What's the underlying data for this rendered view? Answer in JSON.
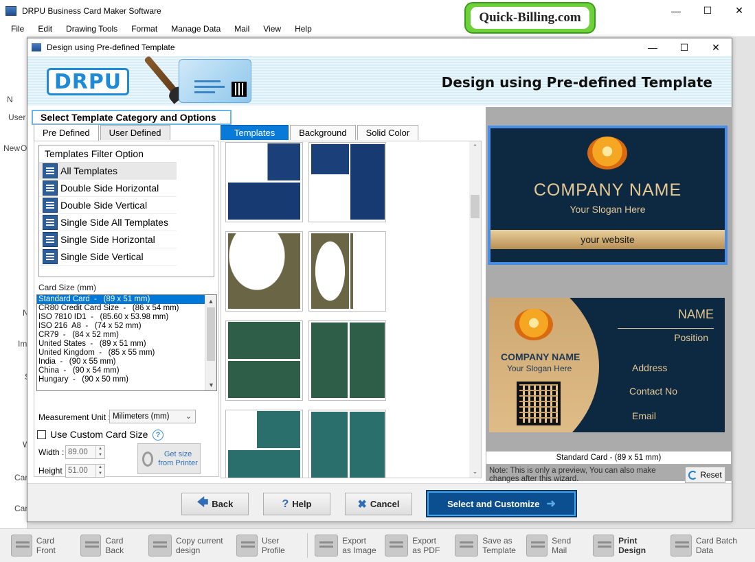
{
  "app": {
    "title": "DRPU Business Card Maker Software",
    "menu": [
      "File",
      "Edit",
      "Drawing Tools",
      "Format",
      "Manage Data",
      "Mail",
      "View",
      "Help"
    ],
    "watermark": "Quick-Billing.com"
  },
  "background": {
    "left_labels": [
      "N",
      "User",
      "New",
      "O",
      "N",
      "Im",
      "S",
      "W",
      "Car",
      "Car"
    ]
  },
  "dialog": {
    "title": "Design using Pre-defined Template",
    "banner_logo": "DRPU",
    "banner_heading": "Design using Pre-defined Template",
    "section_title": "Select Template Category and Options",
    "left_tabs": [
      "Pre Defined",
      "User Defined"
    ],
    "filter": {
      "header": "Templates Filter Option",
      "items": [
        "All Templates",
        "Double Side Horizontal",
        "Double Side Vertical",
        "Single Side All Templates",
        "Single Side Horizontal",
        "Single Side Vertical"
      ],
      "selected": "All Templates"
    },
    "card_size": {
      "label": "Card Size (mm)",
      "items": [
        "Standard Card  -   (89 x 51 mm)",
        "CR80 Credit Card Size  -   (86 x 54 mm)",
        "ISO 7810 ID1  -   (85.60 x 53.98 mm)",
        "ISO 216  A8  -   (74 x 52 mm)",
        "CR79  -   (84 x 52 mm)",
        "United States  -   (89 x 51 mm)",
        "United Kingdom  -   (85 x 55 mm)",
        "India  -   (90 x 55 mm)",
        "China  -   (90 x 54 mm)",
        "Hungary  -   (90 x 50 mm)"
      ],
      "selected": "Standard Card  -   (89 x 51 mm)"
    },
    "measurement": {
      "label": "Measurement Unit :",
      "value": "Milimeters (mm)"
    },
    "custom_size": {
      "label": "Use Custom Card Size",
      "checked": false
    },
    "width": {
      "label": "Width :",
      "value": "89.00"
    },
    "height": {
      "label": "Height :",
      "value": "51.00"
    },
    "get_size_button": "Get size from Printer",
    "mid_tabs": [
      "Templates",
      "Background",
      "Solid Color"
    ],
    "preview": {
      "front": {
        "company": "COMPANY NAME",
        "slogan": "Your Slogan Here",
        "website": "your website"
      },
      "back": {
        "company": "COMPANY NAME",
        "slogan": "Your Slogan Here",
        "name": "NAME",
        "position": "Position",
        "address": "Address",
        "contact": "Contact  No",
        "email": "Email"
      },
      "caption": "Standard Card  -   (89 x 51 mm)"
    },
    "note": "Note: This is only a preview, You can also make changes after this wizard.",
    "reset": "Reset",
    "buttons": {
      "back": "Back",
      "help": "Help",
      "cancel": "Cancel",
      "select": "Select and Customize"
    }
  },
  "bottom_toolbar": {
    "items": [
      "Card Front",
      "Card Back",
      "Copy current design",
      "User Profile",
      "Export as Image",
      "Export as PDF",
      "Save as Template",
      "Send Mail",
      "Print Design",
      "Card Batch Data"
    ]
  },
  "colors": {
    "accent": "#0a7ad8",
    "card_navy": "#0c2941",
    "card_gold": "#e6c895",
    "watermark_green": "#6fd13a"
  }
}
